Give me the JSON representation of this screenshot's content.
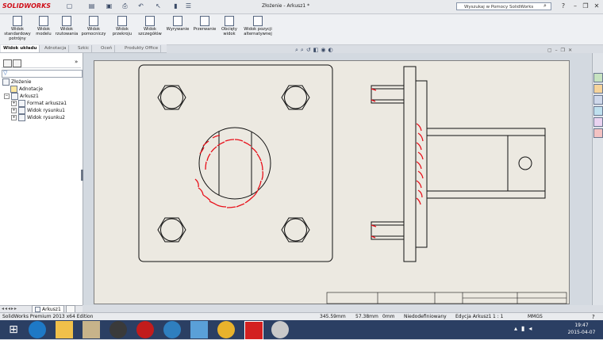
{
  "app": {
    "brand": "SOLIDWORKS",
    "doc_title": "Złożenie - Arkusz1 *",
    "search_placeholder": "Wyszukaj w Pomocy SolidWorks"
  },
  "ribbon": {
    "buttons": [
      {
        "label": "Widok standardowy potrójny"
      },
      {
        "label": "Widok modelu"
      },
      {
        "label": "Widok rzutowania"
      },
      {
        "label": "Widok pomocniczy"
      },
      {
        "label": "Widok przekroju"
      },
      {
        "label": "Widok szczegółów"
      },
      {
        "label": "Wyrywanie"
      },
      {
        "label": "Przerwanie"
      },
      {
        "label": "Obcięty widok"
      },
      {
        "label": "Widok pozycji alternatywnej"
      }
    ]
  },
  "tabs": [
    "Widok układu",
    "Adnotacja",
    "Szkic",
    "Oceń",
    "Produkty Office"
  ],
  "tree": {
    "root": "Złożenie",
    "items": [
      "Adnotacje",
      "Arkusz1",
      "Format arkusza1",
      "Widok rysunku1",
      "Widok rysunku2"
    ]
  },
  "sheet_tab": "Arkusz1",
  "status": {
    "product": "SolidWorks Premium 2013 x64 Edition",
    "x": "345.59mm",
    "y": "57.38mm",
    "z": "0mm",
    "state": "Niedodefiniowany",
    "editing": "Edycja Arkusz1",
    "scale": "1 : 1",
    "units": "MMGS"
  },
  "clock": {
    "time": "19:47",
    "date": "2015-04-07"
  },
  "colors": {
    "markup": "#e8101a",
    "sheet_bg": "#ece9e1",
    "taskbar": "#2b3f63"
  }
}
